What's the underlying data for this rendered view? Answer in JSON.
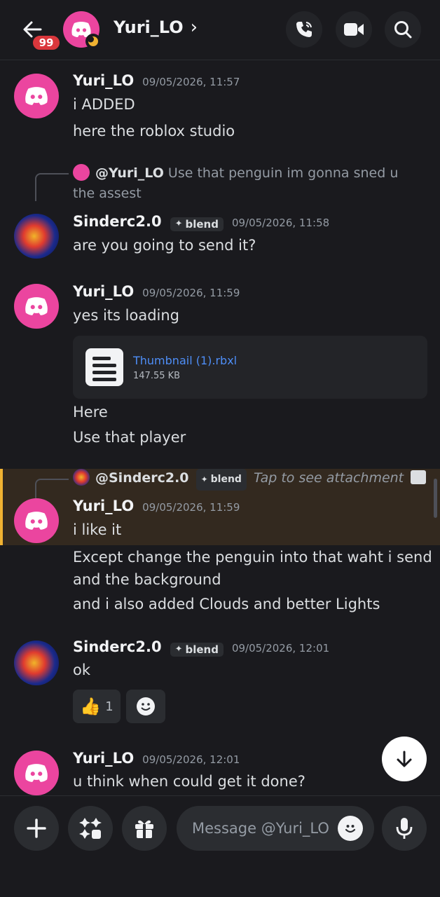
{
  "header": {
    "badge": "99",
    "title": "Yuri_LO",
    "chevron": "›",
    "icons": [
      "back-arrow-icon",
      "phone-icon",
      "video-camera-icon",
      "search-icon"
    ]
  },
  "messages": [
    {
      "author": "Yuri_LO",
      "timestamp": "09/05/2026, 11:57",
      "lines": [
        "i ADDED",
        "here the roblox studio"
      ]
    },
    {
      "reply": {
        "author": "@Yuri_LO",
        "text": "Use that penguin im gonna sned u the assest"
      },
      "author": "Sinderc2.0",
      "tag": "blend",
      "timestamp": "09/05/2026, 11:58",
      "lines": [
        "are you going to send it?"
      ]
    },
    {
      "author": "Yuri_LO",
      "timestamp": "09/05/2026, 11:59",
      "lines": [
        "yes its loading"
      ],
      "attachment": {
        "name": "Thumbnail (1).rbxl",
        "size": "147.55 KB"
      },
      "after": [
        "Here",
        "Use that player"
      ]
    },
    {
      "reply": {
        "author": "@Sinderc2.0",
        "tag": "blend",
        "text": "Tap to see attachment"
      },
      "author": "Yuri_LO",
      "timestamp": "09/05/2026, 11:59",
      "lines": [
        "i like it",
        "Except change the penguin into that waht i send",
        "and the background",
        "and i also added Clouds and better Lights"
      ],
      "highlighted": true
    },
    {
      "author": "Sinderc2.0",
      "tag": "blend",
      "timestamp": "09/05/2026, 12:01",
      "lines": [
        "ok"
      ],
      "reactions": [
        {
          "emoji": "👍",
          "count": "1"
        }
      ]
    },
    {
      "author": "Yuri_LO",
      "timestamp": "09/05/2026, 12:01",
      "lines": [
        "u think when could get it done?"
      ]
    }
  ],
  "composer": {
    "placeholder": "Message @Yuri_LO",
    "icons": [
      "plus-icon",
      "apps-icon",
      "gift-icon",
      "emoji-icon",
      "microphone-icon"
    ]
  },
  "colors": {
    "background": "#1a1a1e",
    "discord_pink": "#eb459f",
    "link": "#4e8ef7",
    "highlight_bar": "#f0b232",
    "badge_red": "#da373c"
  }
}
